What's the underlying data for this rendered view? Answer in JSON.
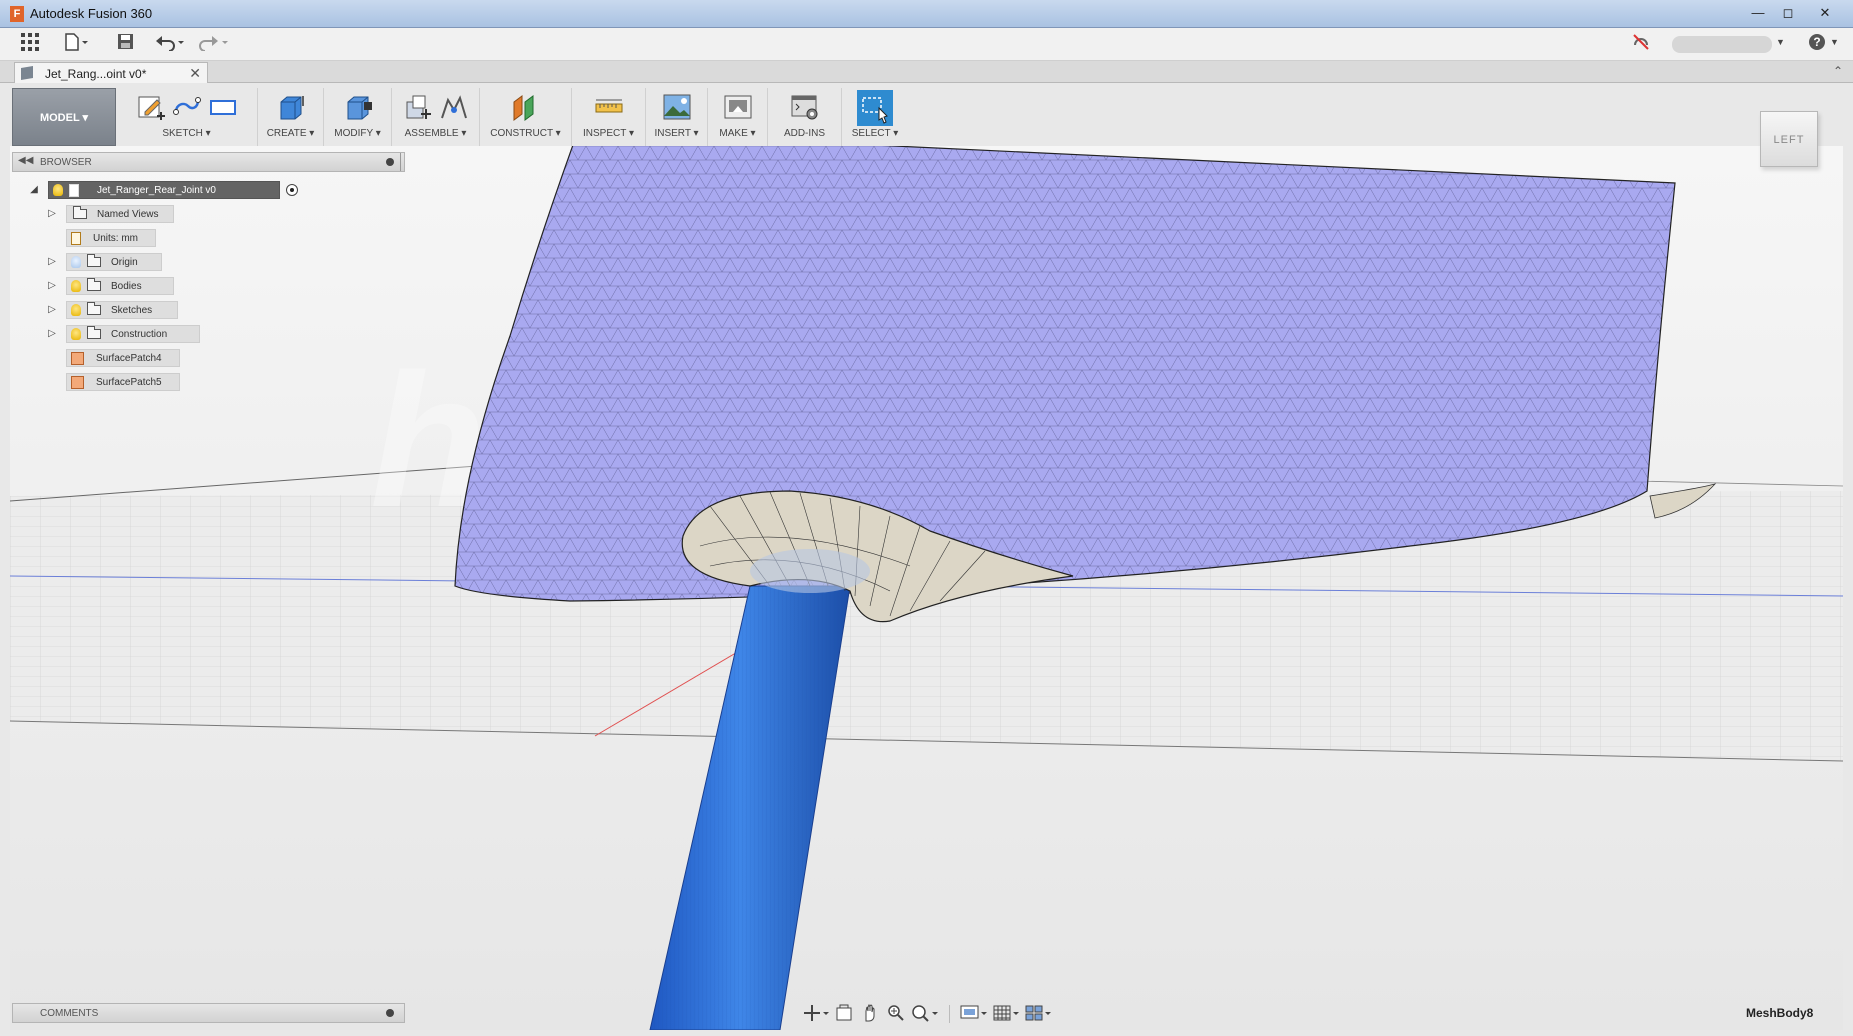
{
  "window": {
    "title": "Autodesk Fusion 360",
    "app_icon_letter": "F",
    "controls": [
      "minimize",
      "maximize",
      "close"
    ]
  },
  "quick_access": {
    "icons": [
      "apps-grid-icon",
      "file-menu-icon",
      "save-icon",
      "undo-icon",
      "redo-icon"
    ],
    "right_icons": [
      "offline-indicator-icon",
      "user-account",
      "help-icon"
    ]
  },
  "document_tab": {
    "label": "Jet_Rang...oint v0*",
    "close": "✕"
  },
  "toolbar": {
    "workspace": "MODEL ▾",
    "groups": [
      {
        "label": "SKETCH ▾",
        "icons": [
          "create-sketch-icon",
          "spline-icon",
          "rectangle-icon"
        ]
      },
      {
        "label": "CREATE ▾",
        "icons": [
          "extrude-box-icon"
        ]
      },
      {
        "label": "MODIFY ▾",
        "icons": [
          "press-pull-icon"
        ]
      },
      {
        "label": "ASSEMBLE ▾",
        "icons": [
          "new-component-icon",
          "joint-icon"
        ]
      },
      {
        "label": "CONSTRUCT ▾",
        "icons": [
          "offset-plane-icon"
        ]
      },
      {
        "label": "INSPECT ▾",
        "icons": [
          "measure-icon"
        ]
      },
      {
        "label": "INSERT ▾",
        "icons": [
          "insert-image-icon"
        ]
      },
      {
        "label": "MAKE ▾",
        "icons": [
          "3d-print-icon"
        ]
      },
      {
        "label": "ADD-INS",
        "icons": [
          "scripts-addins-icon"
        ]
      },
      {
        "label": "SELECT ▾",
        "icons": [
          "select-icon"
        ]
      }
    ]
  },
  "browser": {
    "title": "BROWSER",
    "root": "Jet_Ranger_Rear_Joint v0",
    "items": [
      {
        "label": "Named Views",
        "expandable": true,
        "bulb": false,
        "icon": "folder"
      },
      {
        "label": "Units: mm",
        "expandable": false,
        "bulb": false,
        "icon": "document"
      },
      {
        "label": "Origin",
        "expandable": true,
        "bulb": true,
        "icon": "folder"
      },
      {
        "label": "Bodies",
        "expandable": true,
        "bulb": true,
        "icon": "folder"
      },
      {
        "label": "Sketches",
        "expandable": true,
        "bulb": true,
        "icon": "folder"
      },
      {
        "label": "Construction",
        "expandable": true,
        "bulb": true,
        "icon": "folder"
      },
      {
        "label": "SurfacePatch4",
        "expandable": false,
        "bulb": false,
        "icon": "patch"
      },
      {
        "label": "SurfacePatch5",
        "expandable": false,
        "bulb": false,
        "icon": "patch"
      }
    ]
  },
  "viewcube": {
    "face": "LEFT"
  },
  "comments": {
    "title": "COMMENTS"
  },
  "navbar": {
    "tools": [
      "orbit-icon",
      "look-at-icon",
      "pan-icon",
      "zoom-icon",
      "fit-icon",
      "display-settings-icon",
      "grid-settings-icon",
      "viewports-icon"
    ]
  },
  "status": {
    "selected": "MeshBody8"
  },
  "colors": {
    "mesh_fill": "#a9a9f0",
    "patch_fill": "#dcd6c6",
    "shaft": "#2f6fd8",
    "select_active": "#2e8bd0"
  }
}
